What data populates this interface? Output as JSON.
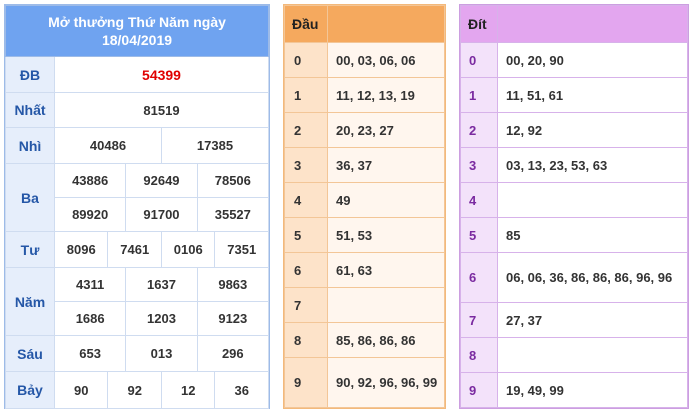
{
  "results": {
    "title_line1": "Mở thưởng Thứ Năm ngày",
    "title_line2": "18/04/2019",
    "db": {
      "label": "ĐB",
      "value": "54399"
    },
    "nhat": {
      "label": "Nhất",
      "value": "81519"
    },
    "nhi": {
      "label": "Nhì",
      "values": [
        "40486",
        "17385"
      ]
    },
    "ba": {
      "label": "Ba",
      "values": [
        "43886",
        "92649",
        "78506",
        "89920",
        "91700",
        "35527"
      ]
    },
    "tu": {
      "label": "Tư",
      "values": [
        "8096",
        "7461",
        "0106",
        "7351"
      ]
    },
    "nam": {
      "label": "Năm",
      "values": [
        "4311",
        "1637",
        "9863",
        "1686",
        "1203",
        "9123"
      ]
    },
    "sau": {
      "label": "Sáu",
      "values": [
        "653",
        "013",
        "296"
      ]
    },
    "bay": {
      "label": "Bảy",
      "values": [
        "90",
        "92",
        "12",
        "36"
      ]
    }
  },
  "dau": {
    "header": "Đầu",
    "rows": [
      {
        "k": "0",
        "v": "00, 03, 06, 06"
      },
      {
        "k": "1",
        "v": "11, 12, 13, 19"
      },
      {
        "k": "2",
        "v": "20, 23, 27"
      },
      {
        "k": "3",
        "v": "36, 37"
      },
      {
        "k": "4",
        "v": "49"
      },
      {
        "k": "5",
        "v": "51, 53"
      },
      {
        "k": "6",
        "v": "61, 63"
      },
      {
        "k": "7",
        "v": ""
      },
      {
        "k": "8",
        "v": "85, 86, 86, 86"
      },
      {
        "k": "9",
        "v": "90, 92, 96, 96, 99"
      }
    ]
  },
  "dit": {
    "header": "Đít",
    "rows": [
      {
        "k": "0",
        "v": "00, 20, 90"
      },
      {
        "k": "1",
        "v": "11, 51, 61"
      },
      {
        "k": "2",
        "v": "12, 92"
      },
      {
        "k": "3",
        "v": "03, 13, 23, 53, 63"
      },
      {
        "k": "4",
        "v": ""
      },
      {
        "k": "5",
        "v": "85"
      },
      {
        "k": "6",
        "v": "06, 06, 36, 86, 86, 86, 96, 96"
      },
      {
        "k": "7",
        "v": "27, 37"
      },
      {
        "k": "8",
        "v": ""
      },
      {
        "k": "9",
        "v": "19, 49, 99"
      }
    ]
  }
}
